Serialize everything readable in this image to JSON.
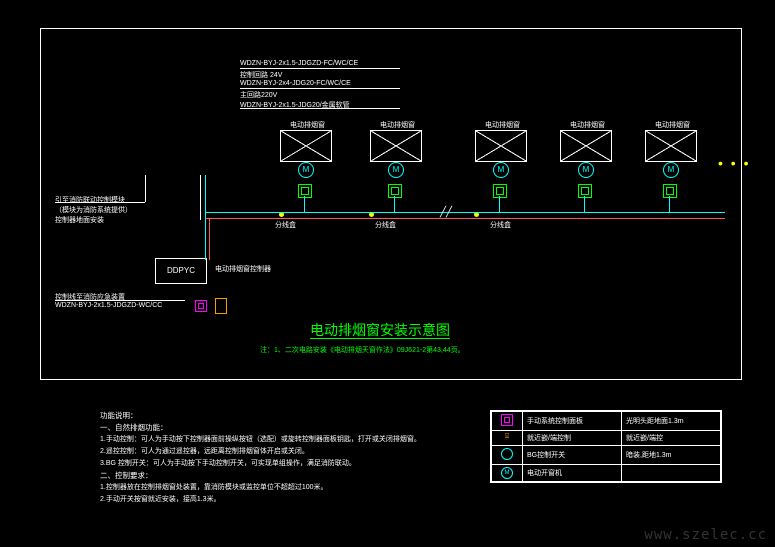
{
  "cables": {
    "c1": "WDZN-BYJ-2x1.5-JDGZD-FC/WC/CE",
    "c1_note": "控制回路 24V",
    "c2": "WDZN-BYJ-2x4-JDG20-FC/WC/CE",
    "c2_note": "主回路220V",
    "c3": "WDZN-BYJ-2x1.5-JDG20/金属软管",
    "c4": "WDZN-BYJ-2x1.5-JDGZD-WC/CC"
  },
  "labels": {
    "window": "电动排烟窗",
    "junction": "分线盒",
    "controller": "DDPYC",
    "controller_label": "电动排烟窗控制器",
    "fire_module_l1": "引至消防联动控制模块",
    "fire_module_l2": "（模块为消防系统提供）",
    "fire_module_l3": "控制器地面安装",
    "to_fire_bus": "控制线至消防应急装置",
    "motor": "M"
  },
  "title": "电动排烟窗安装示意图",
  "title_note": "注：1、二次电路安装《电动排烟天窗作法》09J621-2第43,44页。",
  "notes": {
    "heading": "功能说明：",
    "s1": "一、自然排烟功能：",
    "s1_1": "1.手动控制：可人为手动按下控制器面前操纵按钮（选配）或旋转控制器面板钥匙，打开或关闭排烟窗。",
    "s1_2": "2.遥控控制：可人为通过遥控器，远距离控制排烟窗体开启或关闭。",
    "s1_3": "3.BG 控制开关：可人为手动按下手动控制开关，可实现单组操作，满足消防联动。",
    "s2": "二、控制要求：",
    "s2_1": "1.控制器放在控制排烟窗处装置，靠消防模块或监控单位不超超过100米。",
    "s2_2": "2.手动开关按窗就近安装，接高1.3米。"
  },
  "legend": {
    "rows": [
      {
        "sym": "box",
        "label": "手动系统控制面板",
        "note": "光明头距地面1.3m"
      },
      {
        "sym": "switch",
        "label": "就近嵌/端控制",
        "note": "就近嵌/端控"
      },
      {
        "sym": "bg",
        "label": "BG控制开关",
        "note": "暗装,距地1.3m"
      },
      {
        "sym": "motor",
        "label": "电动开窗机",
        "note": ""
      }
    ]
  },
  "watermark": "www.szelec.cc"
}
